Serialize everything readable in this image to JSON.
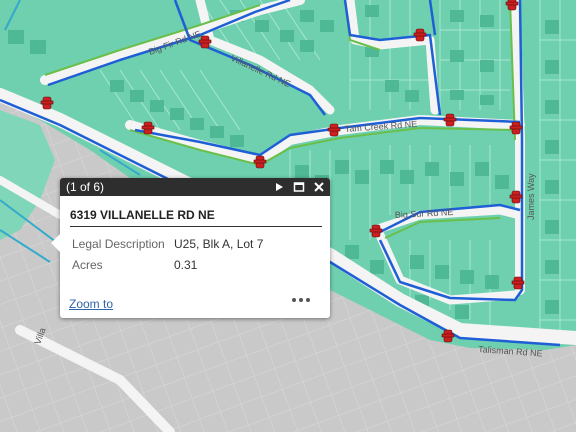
{
  "map": {
    "colors": {
      "background": "#c9c9c9",
      "parcel_fill": "#6fd0b0",
      "parcel_line": "#9ee3cb",
      "building": "#4fb996",
      "road": "#f2f2f2",
      "water_main": "#1f5fd6",
      "service_line": "#33aacc",
      "green_line": "#6abf4b",
      "hydrant": "#cc1f1f"
    },
    "icons": [
      "fire-hydrant-icon"
    ],
    "street_labels": [
      "Big Fir Rd NE",
      "Villanelle Rd NE",
      "Tam Creek Rd NE",
      "Big Sur Rd NE",
      "James Way",
      "Talisman Rd NE",
      "Villa"
    ]
  },
  "popup": {
    "count": "(1 of 6)",
    "title": "6319 VILLANELLE RD NE",
    "fields": [
      {
        "label": "Legal Description",
        "value": "U25, Blk A, Lot 7"
      },
      {
        "label": "Acres",
        "value": "0.31"
      }
    ],
    "zoom_label": "Zoom to",
    "icons": {
      "next": "play-icon",
      "maximize": "maximize-icon",
      "close": "close-icon",
      "more": "ellipsis-icon"
    }
  }
}
